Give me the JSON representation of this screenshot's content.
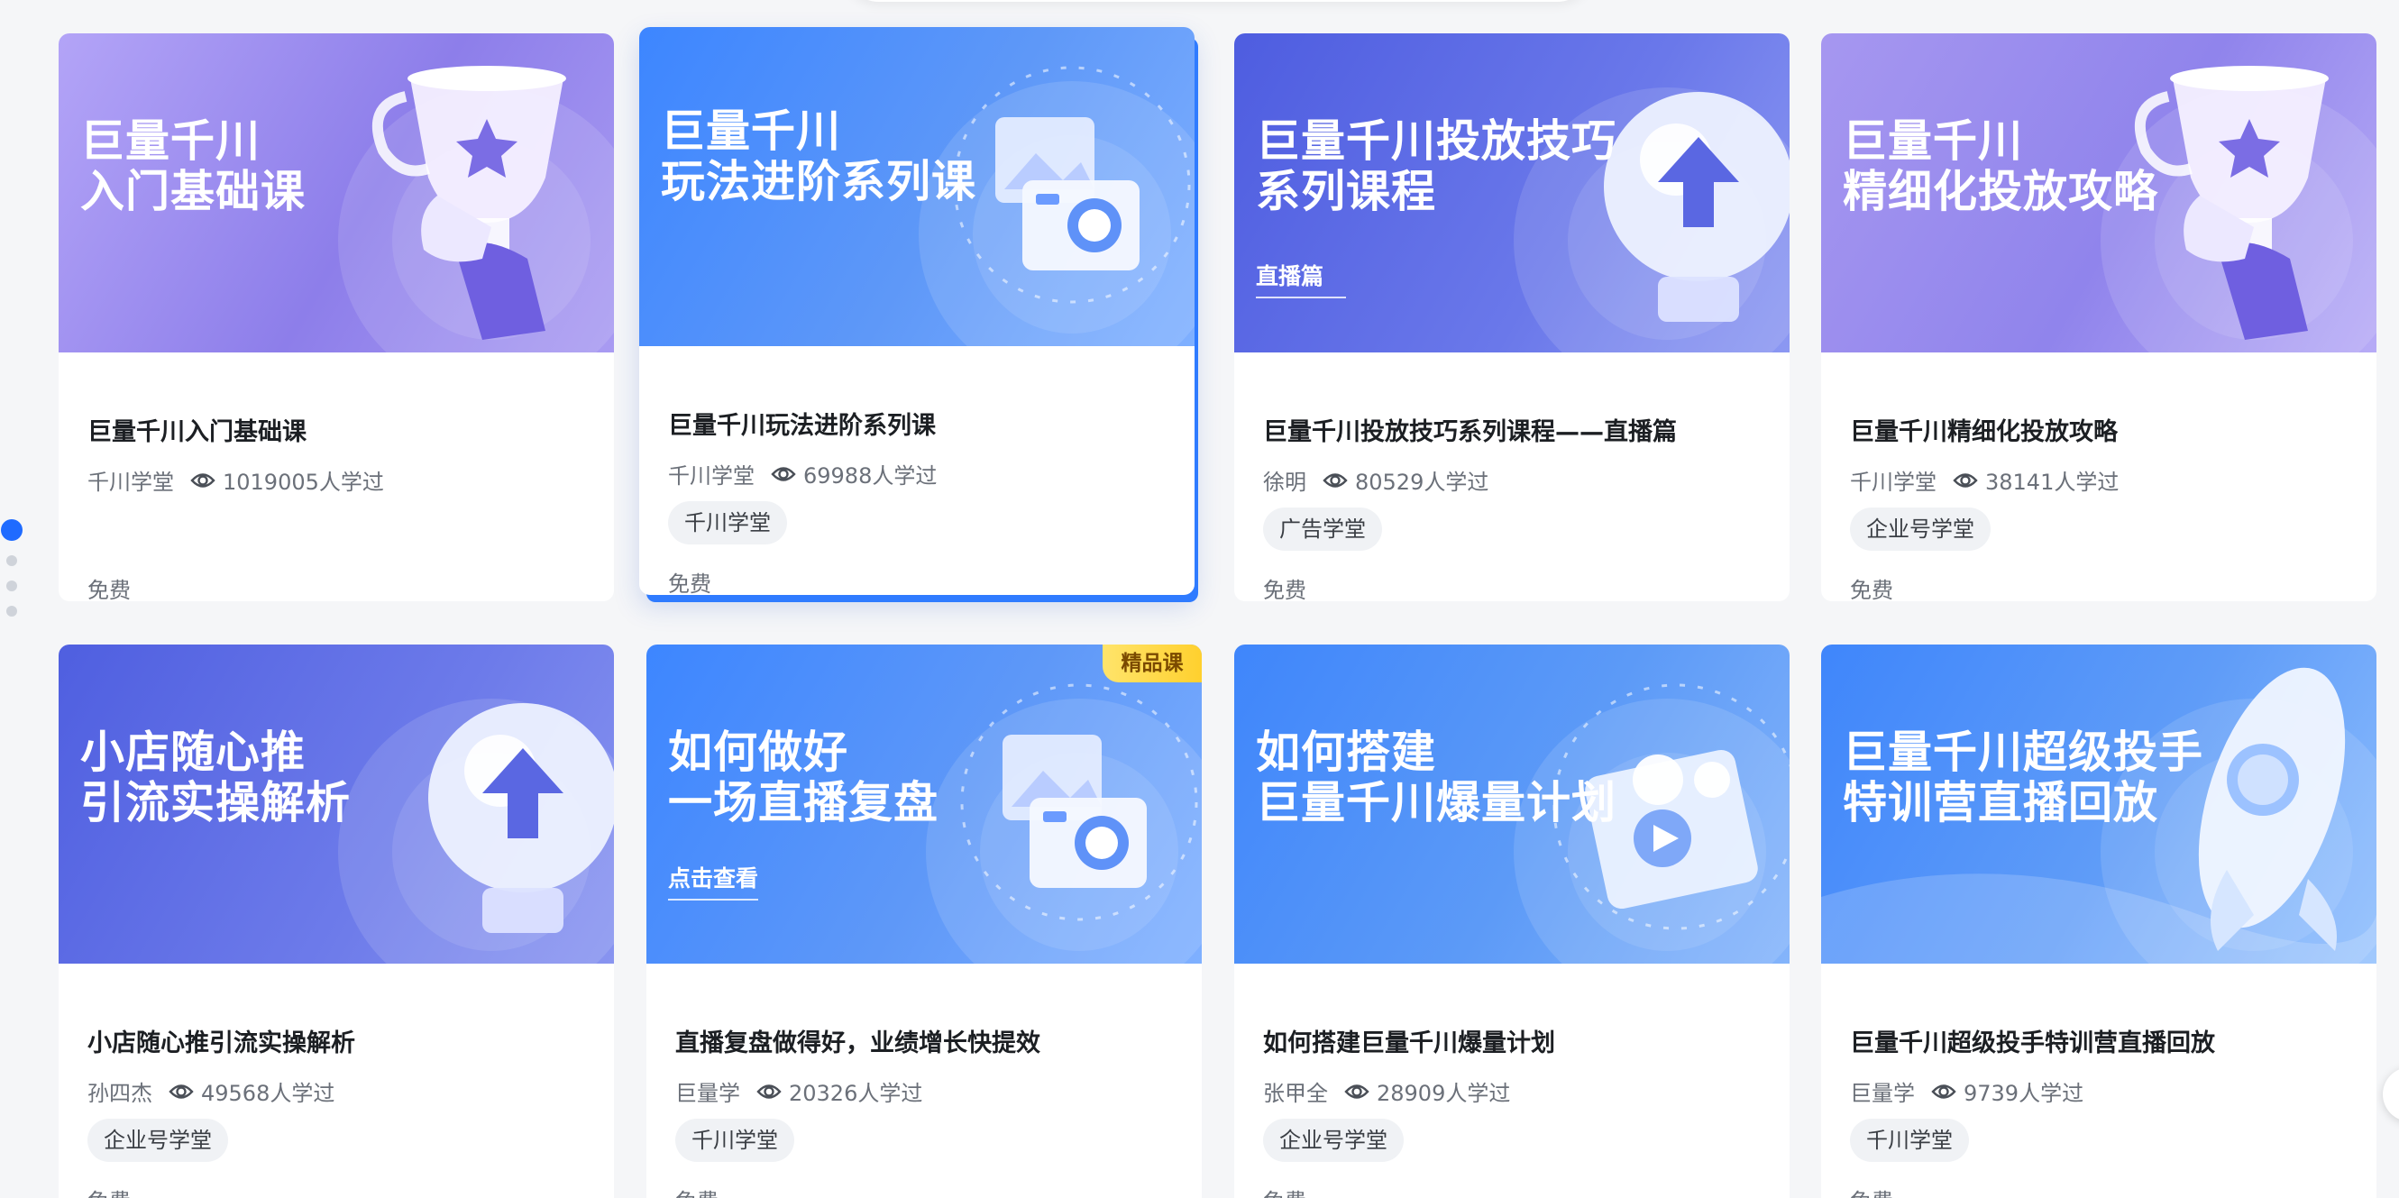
{
  "courses": [
    {
      "banner": "巨量千川\n入门基础课",
      "banner_sub": "",
      "title": "巨量千川入门基础课",
      "author": "千川学堂",
      "learners": "1019005人学过",
      "tag": "",
      "price": "免费",
      "badge": ""
    },
    {
      "banner": "巨量千川\n玩法进阶系列课",
      "banner_sub": "",
      "title": "巨量千川玩法进阶系列课",
      "author": "千川学堂",
      "learners": "69988人学过",
      "tag": "千川学堂",
      "price": "免费",
      "badge": ""
    },
    {
      "banner": "巨量千川投放技巧\n系列课程",
      "banner_sub": "直播篇",
      "title": "巨量千川投放技巧系列课程——直播篇",
      "author": "徐明",
      "learners": "80529人学过",
      "tag": "广告学堂",
      "price": "免费",
      "badge": ""
    },
    {
      "banner": "巨量千川\n精细化投放攻略",
      "banner_sub": "",
      "title": "巨量千川精细化投放攻略",
      "author": "千川学堂",
      "learners": "38141人学过",
      "tag": "企业号学堂",
      "price": "免费",
      "badge": ""
    },
    {
      "banner": "小店随心推\n引流实操解析",
      "banner_sub": "",
      "title": "小店随心推引流实操解析",
      "author": "孙四杰",
      "learners": "49568人学过",
      "tag": "企业号学堂",
      "price": "免费",
      "badge": ""
    },
    {
      "banner": "如何做好\n一场直播复盘",
      "banner_sub": "点击查看",
      "title": "直播复盘做得好，业绩增长快提效",
      "author": "巨量学",
      "learners": "20326人学过",
      "tag": "千川学堂",
      "price": "免费",
      "badge": "精品课"
    },
    {
      "banner": "如何搭建\n巨量千川爆量计划",
      "banner_sub": "",
      "title": "如何搭建巨量千川爆量计划",
      "author": "张甲全",
      "learners": "28909人学过",
      "tag": "企业号学堂",
      "price": "免费",
      "badge": ""
    },
    {
      "banner": "巨量千川超级投手\n特训营直播回放",
      "banner_sub": "",
      "title": "巨量千川超级投手特训营直播回放",
      "author": "巨量学",
      "learners": "9739人学过",
      "tag": "千川学堂",
      "price": "免费",
      "badge": ""
    }
  ],
  "colors": {
    "accent": "#1f6bff",
    "purple_banner": "#9b8cf0",
    "blue_banner": "#4f8af7",
    "indigo_banner": "#5d6fe6"
  },
  "icons": {
    "view": "eye-icon",
    "trophy": "trophy-icon",
    "bulb": "lightbulb-icon",
    "photo": "photo-icon",
    "rocket": "rocket-icon",
    "video": "video-icon"
  },
  "pager": {
    "count": 4,
    "active": 1
  }
}
